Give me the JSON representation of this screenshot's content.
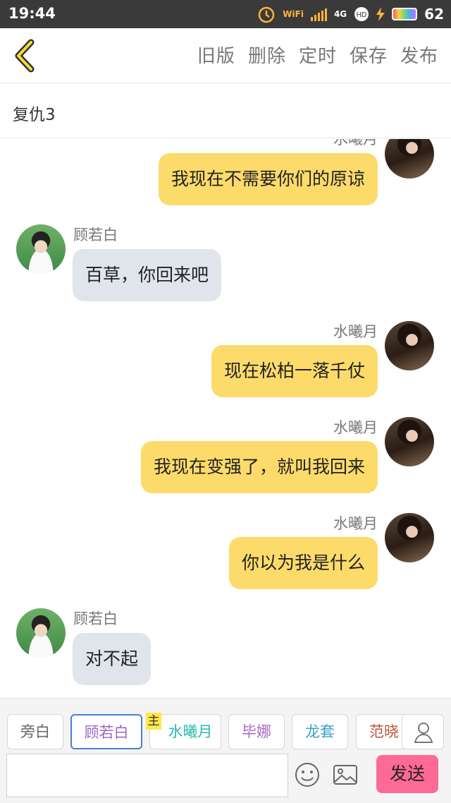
{
  "status_bar": {
    "time": "19:44",
    "wifi_label": "WiFi",
    "network": "4G",
    "battery": "62"
  },
  "toolbar": {
    "actions": [
      "旧版",
      "删除",
      "定时",
      "保存",
      "发布"
    ]
  },
  "title": "复仇3",
  "messages": [
    {
      "side": "right",
      "name": "水曦月",
      "text": "我现在不需要你们的原谅"
    },
    {
      "side": "left",
      "name": "顾若白",
      "text": "百草，你回来吧"
    },
    {
      "side": "right",
      "name": "水曦月",
      "text": "现在松柏一落千仗"
    },
    {
      "side": "right",
      "name": "水曦月",
      "text": "我现在变强了，就叫我回来"
    },
    {
      "side": "right",
      "name": "水曦月",
      "text": "你以为我是什么"
    },
    {
      "side": "left",
      "name": "顾若白",
      "text": "对不起"
    }
  ],
  "characters": [
    {
      "name": "旁白",
      "color": "#666666"
    },
    {
      "name": "顾若白",
      "color": "#9a66c8",
      "selected": true
    },
    {
      "name": "水曦月",
      "color": "#2ab8b0",
      "badge": "主"
    },
    {
      "name": "毕娜",
      "color": "#a36ac4"
    },
    {
      "name": "龙套",
      "color": "#3aa0c8"
    },
    {
      "name": "范晓",
      "color": "#c0533a"
    }
  ],
  "composer": {
    "placeholder": "",
    "send_label": "发送"
  },
  "colors": {
    "bubble_right": "#fddb6b",
    "bubble_left": "#dfe5ea",
    "send": "#fe6a96"
  }
}
